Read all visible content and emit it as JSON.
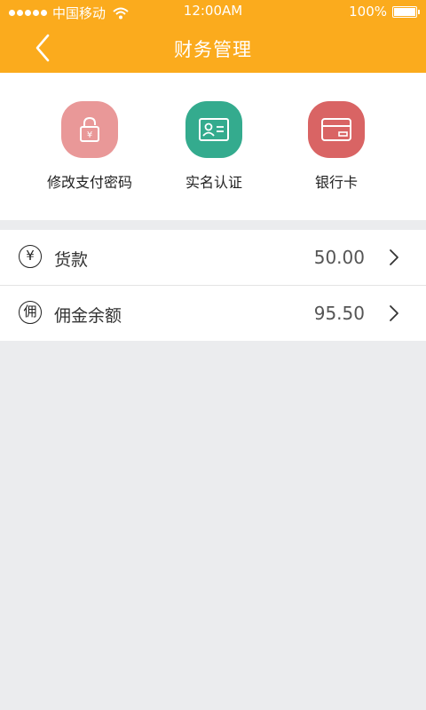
{
  "status": {
    "carrier": "中国移动",
    "time": "12:00AM",
    "battery": "100%"
  },
  "header": {
    "title": "财务管理",
    "back_icon": "chevron-left-icon"
  },
  "quick_actions": [
    {
      "label": "修改支付密码",
      "icon": "lock-yuan-icon",
      "color": "#e99898"
    },
    {
      "label": "实名认证",
      "icon": "id-card-icon",
      "color": "#34ab8e"
    },
    {
      "label": "银行卡",
      "icon": "bank-card-icon",
      "color": "#d96464"
    }
  ],
  "accounts": [
    {
      "badge": "¥",
      "label": "货款",
      "value": "50.00"
    },
    {
      "badge": "佣",
      "label": "佣金余额",
      "value": "95.50"
    }
  ],
  "colors": {
    "header": "#fbab1d",
    "background": "#ebecee"
  }
}
